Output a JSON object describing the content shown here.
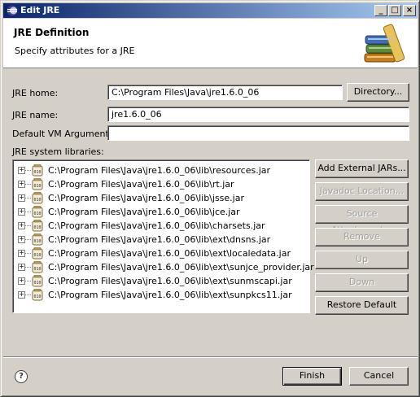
{
  "window": {
    "title": "Edit JRE",
    "minimize": "_",
    "maximize": "□",
    "close": "×"
  },
  "header": {
    "title": "JRE Definition",
    "subtitle": "Specify attributes for a JRE"
  },
  "form": {
    "jre_home_label": "JRE home:",
    "jre_home_value": "C:\\Program Files\\Java\\jre1.6.0_06",
    "directory_button": "Directory...",
    "jre_name_label": "JRE name:",
    "jre_name_value": "jre1.6.0_06",
    "vm_args_label": "Default VM Arguments:",
    "vm_args_value": "",
    "libraries_label": "JRE system libraries:"
  },
  "libraries": [
    "C:\\Program Files\\Java\\jre1.6.0_06\\lib\\resources.jar",
    "C:\\Program Files\\Java\\jre1.6.0_06\\lib\\rt.jar",
    "C:\\Program Files\\Java\\jre1.6.0_06\\lib\\jsse.jar",
    "C:\\Program Files\\Java\\jre1.6.0_06\\lib\\jce.jar",
    "C:\\Program Files\\Java\\jre1.6.0_06\\lib\\charsets.jar",
    "C:\\Program Files\\Java\\jre1.6.0_06\\lib\\ext\\dnsns.jar",
    "C:\\Program Files\\Java\\jre1.6.0_06\\lib\\ext\\localedata.jar",
    "C:\\Program Files\\Java\\jre1.6.0_06\\lib\\ext\\sunjce_provider.jar",
    "C:\\Program Files\\Java\\jre1.6.0_06\\lib\\ext\\sunmscapi.jar",
    "C:\\Program Files\\Java\\jre1.6.0_06\\lib\\ext\\sunpkcs11.jar"
  ],
  "jar_icon_text": "010",
  "side_buttons": {
    "add_external": "Add External JARs...",
    "javadoc": "Javadoc Location...",
    "source": "Source Attachment...",
    "remove": "Remove",
    "up": "Up",
    "down": "Down",
    "restore": "Restore Default"
  },
  "footer": {
    "help": "?",
    "finish": "Finish",
    "cancel": "Cancel"
  }
}
